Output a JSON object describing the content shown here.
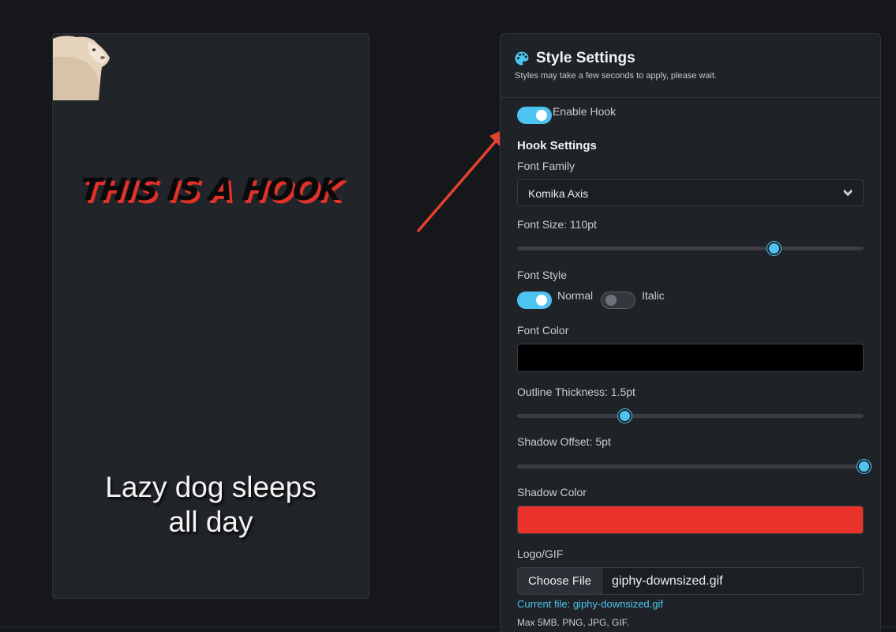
{
  "preview": {
    "hook_text": "THIS IS A HOOK",
    "caption_line1": "Lazy dog sleeps",
    "caption_line2": "all day"
  },
  "panel": {
    "title": "Style Settings",
    "title_icon": "palette-icon",
    "subtitle": "Styles may take a few seconds to apply, please wait.",
    "enable_hook": {
      "label": "Enable Hook",
      "on": true
    },
    "section_title": "Hook Settings",
    "font_family": {
      "label": "Font Family",
      "value": "Komika Axis",
      "icon": "chevron-down-icon"
    },
    "font_size": {
      "label": "Font Size: 110pt",
      "fraction": 0.74
    },
    "font_style": {
      "label": "Font Style",
      "normal": {
        "label": "Normal",
        "on": true
      },
      "italic": {
        "label": "Italic",
        "on": false
      }
    },
    "font_color": {
      "label": "Font Color",
      "value": "#000000"
    },
    "outline": {
      "label": "Outline Thickness: 1.5pt",
      "fraction": 0.31
    },
    "shadow_offset": {
      "label": "Shadow Offset: 5pt",
      "fraction": 1.0
    },
    "shadow_color": {
      "label": "Shadow Color",
      "value": "#e8322a"
    },
    "logo": {
      "label": "Logo/GIF",
      "button": "Choose File",
      "file_name": "giphy-downsized.gif",
      "current_prefix": "Current file:",
      "current_name": "giphy-downsized.gif",
      "max_note": "Max 5MB. PNG, JPG, GIF."
    }
  },
  "colors": {
    "accent": "#4cc3f0",
    "annotation_arrow": "#e5412f"
  }
}
